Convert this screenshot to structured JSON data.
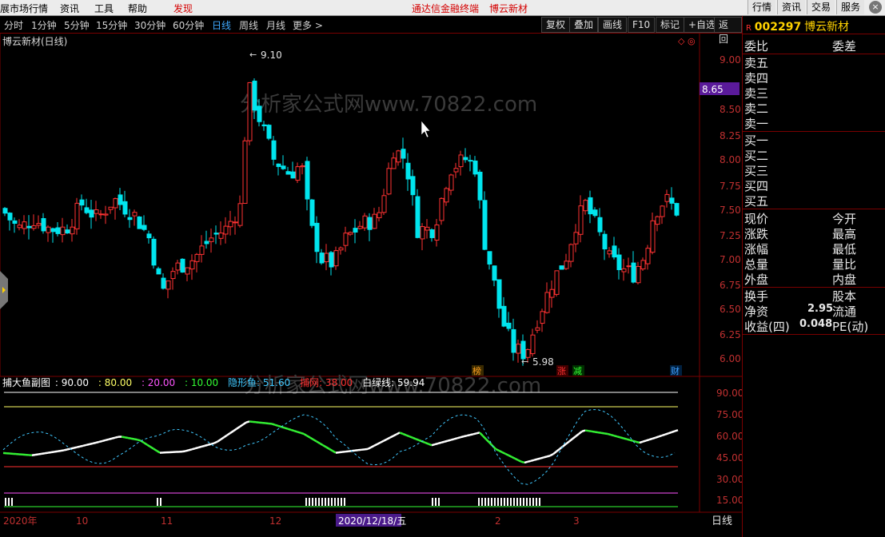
{
  "menu": {
    "items": [
      "展市场行情",
      "资讯",
      "工具",
      "帮助",
      "发现"
    ],
    "center_links": [
      "通达信金融终端",
      "博云新材"
    ],
    "right_buttons": [
      "行情",
      "资讯",
      "交易",
      "服务"
    ],
    "close": "×"
  },
  "periods": [
    "分时",
    "1分钟",
    "5分钟",
    "15分钟",
    "30分钟",
    "60分钟",
    "日线",
    "周线",
    "月线",
    "更多 >"
  ],
  "active_period": "日线",
  "toolbar": [
    "复权",
    "叠加",
    "画线",
    "F10",
    "标记",
    "+自选",
    "返回"
  ],
  "chart_title": "博云新材(日线)",
  "stock": {
    "badge": "R",
    "code": "002297",
    "name": "博云新材"
  },
  "order_book": {
    "header": [
      "委比",
      "委差"
    ],
    "sell": [
      "卖五",
      "卖四",
      "卖三",
      "卖二",
      "卖一"
    ],
    "buy": [
      "买一",
      "买二",
      "买三",
      "买四",
      "买五"
    ]
  },
  "quote": {
    "rows": [
      {
        "l": "现价",
        "r": "今开"
      },
      {
        "l": "涨跌",
        "r": "最高"
      },
      {
        "l": "涨幅",
        "r": "最低"
      },
      {
        "l": "总量",
        "r": "量比"
      },
      {
        "l": "外盘",
        "r": "内盘"
      }
    ],
    "rows2": [
      {
        "l": "换手",
        "v": "",
        "r": "股本"
      },
      {
        "l": "净资",
        "v": "2.95",
        "r": "流通"
      },
      {
        "l": "收益(四)",
        "v": "0.048",
        "r": "PE(动)"
      }
    ]
  },
  "price_axis": [
    "9.00",
    "8.75",
    "8.50",
    "8.25",
    "8.00",
    "7.75",
    "7.50",
    "7.25",
    "7.00",
    "6.75",
    "6.50",
    "6.25",
    "6.00"
  ],
  "price_cursor": "8.65",
  "high_label": "9.10",
  "low_label": "5.98",
  "watermark": "分析家公式网www.70822.com",
  "event_tags": [
    "榜",
    "涨",
    "减",
    "财"
  ],
  "indicator": {
    "name": "捕大鱼副图",
    "params": [
      {
        "text": ": 90.00",
        "color": "#ffffff"
      },
      {
        "text": ": 80.00",
        "color": "#ffff66"
      },
      {
        "text": ": 20.00",
        "color": "#ff55ff"
      },
      {
        "text": ": 10.00",
        "color": "#33ff33"
      },
      {
        "text": "隐形鱼: 51.60",
        "color": "#40c8ff"
      },
      {
        "text": "捕网: 38.00",
        "color": "#ff3333"
      },
      {
        "text": "白绿线: 59.94",
        "color": "#ffffff"
      }
    ],
    "axis": [
      "90.00",
      "75.00",
      "60.00",
      "45.00",
      "30.00",
      "15.00"
    ]
  },
  "date_axis": [
    "2020年",
    "10",
    "11",
    "12",
    "2",
    "3"
  ],
  "date_cursor": "2020/12/18/五",
  "bottom_right": "日线",
  "colors": {
    "up": "#ff3232",
    "down": "#00e5ee",
    "grid": "#7a0000",
    "accent": "#ffd200"
  }
}
